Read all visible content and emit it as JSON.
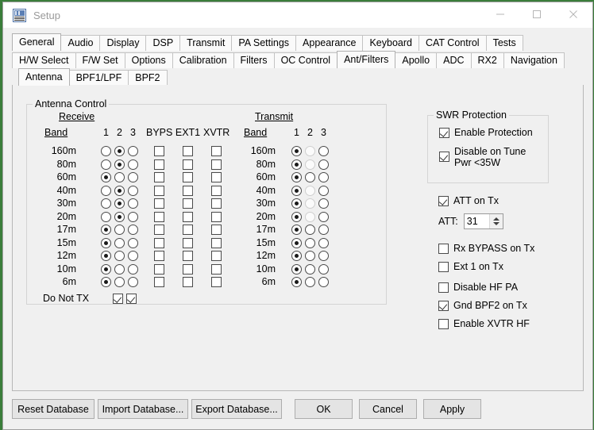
{
  "window": {
    "title": "Setup",
    "icon": "setup-app-icon",
    "controls": {
      "minimize": "minimize-icon",
      "maximize": "maximize-icon",
      "close": "close-icon"
    }
  },
  "tabs": {
    "row1": [
      {
        "label": "General",
        "selected": true
      },
      {
        "label": "Audio",
        "selected": false
      },
      {
        "label": "Display",
        "selected": false
      },
      {
        "label": "DSP",
        "selected": false
      },
      {
        "label": "Transmit",
        "selected": false
      },
      {
        "label": "PA Settings",
        "selected": false
      },
      {
        "label": "Appearance",
        "selected": false
      },
      {
        "label": "Keyboard",
        "selected": false
      },
      {
        "label": "CAT Control",
        "selected": false
      },
      {
        "label": "Tests",
        "selected": false
      }
    ],
    "row2": [
      {
        "label": "H/W Select",
        "selected": false
      },
      {
        "label": "F/W Set",
        "selected": false
      },
      {
        "label": "Options",
        "selected": false
      },
      {
        "label": "Calibration",
        "selected": false
      },
      {
        "label": "Filters",
        "selected": false
      },
      {
        "label": "OC Control",
        "selected": false
      },
      {
        "label": "Ant/Filters",
        "selected": true
      },
      {
        "label": "Apollo",
        "selected": false
      },
      {
        "label": "ADC",
        "selected": false
      },
      {
        "label": "RX2",
        "selected": false
      },
      {
        "label": "Navigation",
        "selected": false
      }
    ],
    "row3": [
      {
        "label": "Antenna",
        "selected": true
      },
      {
        "label": "BPF1/LPF",
        "selected": false
      },
      {
        "label": "BPF2",
        "selected": false
      }
    ]
  },
  "antenna_control": {
    "group_title": "Antenna Control",
    "receive": {
      "section_label": "Receive",
      "band_label": "Band",
      "columns": [
        "1",
        "2",
        "3"
      ],
      "check_columns": [
        "BYPS",
        "EXT1",
        "XVTR"
      ],
      "rows": [
        {
          "band": "160m",
          "antenna": 2,
          "byps": false,
          "ext1": false,
          "xvtr": false
        },
        {
          "band": "80m",
          "antenna": 2,
          "byps": false,
          "ext1": false,
          "xvtr": false
        },
        {
          "band": "60m",
          "antenna": 1,
          "byps": false,
          "ext1": false,
          "xvtr": false
        },
        {
          "band": "40m",
          "antenna": 2,
          "byps": false,
          "ext1": false,
          "xvtr": false
        },
        {
          "band": "30m",
          "antenna": 2,
          "byps": false,
          "ext1": false,
          "xvtr": false
        },
        {
          "band": "20m",
          "antenna": 2,
          "byps": false,
          "ext1": false,
          "xvtr": false
        },
        {
          "band": "17m",
          "antenna": 1,
          "byps": false,
          "ext1": false,
          "xvtr": false
        },
        {
          "band": "15m",
          "antenna": 1,
          "byps": false,
          "ext1": false,
          "xvtr": false
        },
        {
          "band": "12m",
          "antenna": 1,
          "byps": false,
          "ext1": false,
          "xvtr": false
        },
        {
          "band": "10m",
          "antenna": 1,
          "byps": false,
          "ext1": false,
          "xvtr": false
        },
        {
          "band": "6m",
          "antenna": 1,
          "byps": false,
          "ext1": false,
          "xvtr": false
        }
      ],
      "do_not_tx": {
        "label": "Do Not TX",
        "values": [
          false,
          true,
          true
        ]
      }
    },
    "transmit": {
      "section_label": "Transmit",
      "band_label": "Band",
      "columns": [
        "1",
        "2",
        "3"
      ],
      "rows": [
        {
          "band": "160m",
          "antenna": 1,
          "disabled": [
            2
          ]
        },
        {
          "band": "80m",
          "antenna": 1,
          "disabled": [
            2
          ]
        },
        {
          "band": "60m",
          "antenna": 1,
          "disabled": []
        },
        {
          "band": "40m",
          "antenna": 1,
          "disabled": [
            2
          ]
        },
        {
          "band": "30m",
          "antenna": 1,
          "disabled": [
            2
          ]
        },
        {
          "band": "20m",
          "antenna": 1,
          "disabled": [
            2
          ]
        },
        {
          "band": "17m",
          "antenna": 1,
          "disabled": []
        },
        {
          "band": "15m",
          "antenna": 1,
          "disabled": []
        },
        {
          "band": "12m",
          "antenna": 1,
          "disabled": []
        },
        {
          "band": "10m",
          "antenna": 1,
          "disabled": []
        },
        {
          "band": "6m",
          "antenna": 1,
          "disabled": []
        }
      ]
    }
  },
  "swr_protection": {
    "group_title": "SWR Protection",
    "enable_protection": {
      "label": "Enable Protection",
      "checked": true
    },
    "disable_on_tune": {
      "label_line1": "Disable on Tune",
      "label_line2": "Pwr <35W",
      "checked": true
    }
  },
  "att": {
    "on_tx": {
      "label": "ATT on Tx",
      "checked": true
    },
    "field_label": "ATT:",
    "value": "31"
  },
  "options": [
    {
      "label": "Rx BYPASS on Tx",
      "checked": false
    },
    {
      "label": "Ext 1 on Tx",
      "checked": false
    },
    {
      "label": "Disable HF PA",
      "checked": false
    },
    {
      "label": "Gnd BPF2 on Tx",
      "checked": true
    },
    {
      "label": "Enable XVTR HF",
      "checked": false
    }
  ],
  "buttons": {
    "reset_database": "Reset Database",
    "import_database": "Import Database...",
    "export_database": "Export Database...",
    "ok": "OK",
    "cancel": "Cancel",
    "apply": "Apply"
  },
  "colors": {
    "window_bg": "#f0f0f0",
    "titlebar_bg": "#ffffff",
    "tab_selected_bg": "#ffffff",
    "border": "#b7b7b7",
    "button_bg": "#e4e4e4",
    "desktop": "#3a7d3a"
  }
}
